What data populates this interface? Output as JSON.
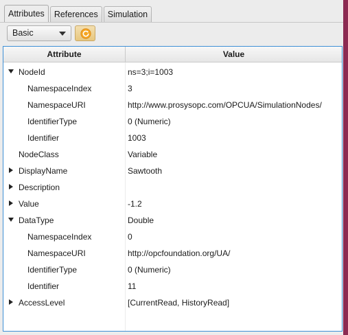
{
  "tabs": [
    {
      "label": "Attributes",
      "active": true
    },
    {
      "label": "References",
      "active": false
    },
    {
      "label": "Simulation",
      "active": false
    }
  ],
  "toolbar": {
    "view_selected": "Basic",
    "refresh_icon": "refresh-icon"
  },
  "table": {
    "columns": [
      "Attribute",
      "Value"
    ],
    "rows": [
      {
        "attribute": "NodeId",
        "value": "ns=3;i=1003",
        "expander": "expanded",
        "level": 0
      },
      {
        "attribute": "NamespaceIndex",
        "value": "3",
        "expander": "none",
        "level": 1
      },
      {
        "attribute": "NamespaceURI",
        "value": "http://www.prosysopc.com/OPCUA/SimulationNodes/",
        "expander": "none",
        "level": 1
      },
      {
        "attribute": "IdentifierType",
        "value": "0 (Numeric)",
        "expander": "none",
        "level": 1
      },
      {
        "attribute": "Identifier",
        "value": "1003",
        "expander": "none",
        "level": 1
      },
      {
        "attribute": "NodeClass",
        "value": "Variable",
        "expander": "none",
        "level": 0
      },
      {
        "attribute": "DisplayName",
        "value": "Sawtooth",
        "expander": "collapsed",
        "level": 0
      },
      {
        "attribute": "Description",
        "value": "",
        "expander": "collapsed",
        "level": 0
      },
      {
        "attribute": "Value",
        "value": "-1.2",
        "expander": "collapsed",
        "level": 0
      },
      {
        "attribute": "DataType",
        "value": "Double",
        "expander": "expanded",
        "level": 0
      },
      {
        "attribute": "NamespaceIndex",
        "value": "0",
        "expander": "none",
        "level": 1
      },
      {
        "attribute": "NamespaceURI",
        "value": "http://opcfoundation.org/UA/",
        "expander": "none",
        "level": 1
      },
      {
        "attribute": "IdentifierType",
        "value": "0 (Numeric)",
        "expander": "none",
        "level": 1
      },
      {
        "attribute": "Identifier",
        "value": "11",
        "expander": "none",
        "level": 1
      },
      {
        "attribute": "AccessLevel",
        "value": "[CurrentRead, HistoryRead]",
        "expander": "collapsed",
        "level": 0
      }
    ]
  },
  "colors": {
    "table_border": "#3d8fd6",
    "refresh_button": "#e8c77e",
    "window_edge": "#8c2a52"
  }
}
